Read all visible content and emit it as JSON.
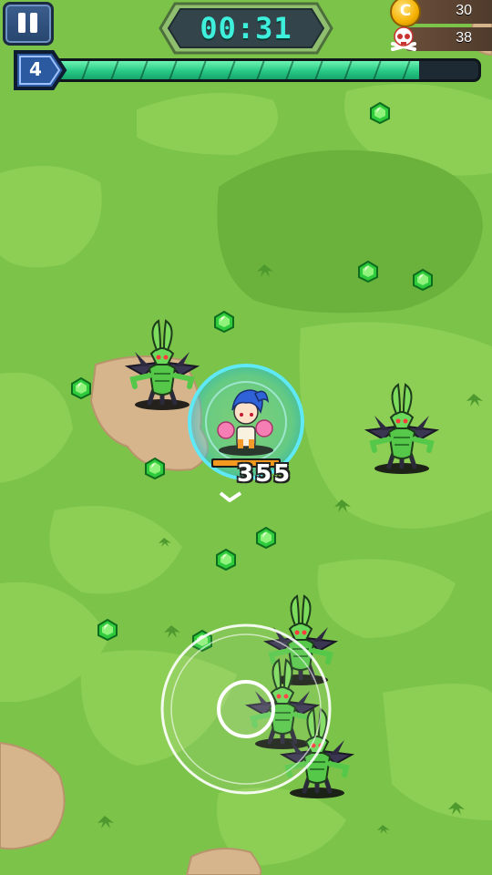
{
  "hud": {
    "timer": "00:31",
    "coins": "30",
    "kills": "38",
    "level": "4",
    "xp_progress": 0.86
  },
  "player": {
    "hp_fraction": 1.0,
    "damage_popup": "355"
  },
  "colors": {
    "grass": "#7cc34a",
    "xp_fill": "#27c985",
    "timer_text": "#3ef0dc",
    "shield": "#4fe6f0"
  },
  "icons": [
    "pause-icon",
    "coin-icon",
    "skull-icon",
    "gem-icon",
    "direction-arrow-icon"
  ]
}
